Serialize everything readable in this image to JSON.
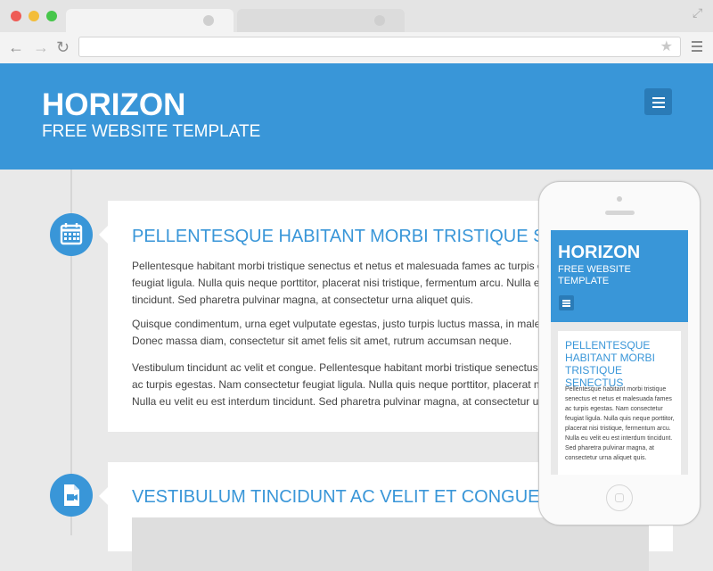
{
  "site": {
    "logo": "HORIZON",
    "tagline": "FREE WEBSITE TEMPLATE"
  },
  "posts": [
    {
      "title": "PELLENTESQUE HABITANT MORBI TRISTIQUE SENECTUS",
      "icon": "calendar-icon",
      "paragraphs": [
        [
          "Pellentesque habitant morbi tristique senectus et netus et malesuada fames ac turpis egestas.",
          "feugiat ligula. Nulla quis neque porttitor, placerat nisi tristique, fermentum arcu. Nulla eu velit eu est interdum",
          "tincidunt. Sed pharetra pulvinar magna, at consectetur urna aliquet quis."
        ],
        [
          "Quisque condimentum, urna eget vulputate egestas, justo turpis luctus massa, in malesuada",
          "Donec massa diam, consectetur sit amet felis sit amet, rutrum accumsan neque."
        ],
        [
          "Vestibulum tincidunt ac velit et congue. Pellentesque habitant morbi tristique senectus et netus",
          "ac turpis egestas. Nam consectetur feugiat ligula. Nulla quis neque porttitor, placerat nisi tristique,",
          "Nulla eu velit eu est interdum tincidunt. Sed pharetra pulvinar magna, at consectetur urna aliquet quis."
        ]
      ]
    },
    {
      "title": "VESTIBULUM TINCIDUNT AC VELIT ET CONGUE",
      "icon": "video-file-icon"
    }
  ],
  "mobile": {
    "logo": "HORIZON",
    "tagline": "FREE WEBSITE TEMPLATE",
    "post_title": "PELLENTESQUE HABITANT MORBI TRISTIQUE SENECTUS",
    "post_body": "Pellentesque habitant morbi tristique senectus et netus et malesuada fames ac turpis egestas. Nam consectetur feugiat ligula. Nulla quis neque porttitor, placerat nisi tristique, fermentum arcu. Nulla eu velit eu est interdum tincidunt. Sed pharetra pulvinar magna, at consectetur urna aliquet quis."
  },
  "colors": {
    "accent": "#3996d8",
    "accent_dark": "#2a7bb7"
  }
}
